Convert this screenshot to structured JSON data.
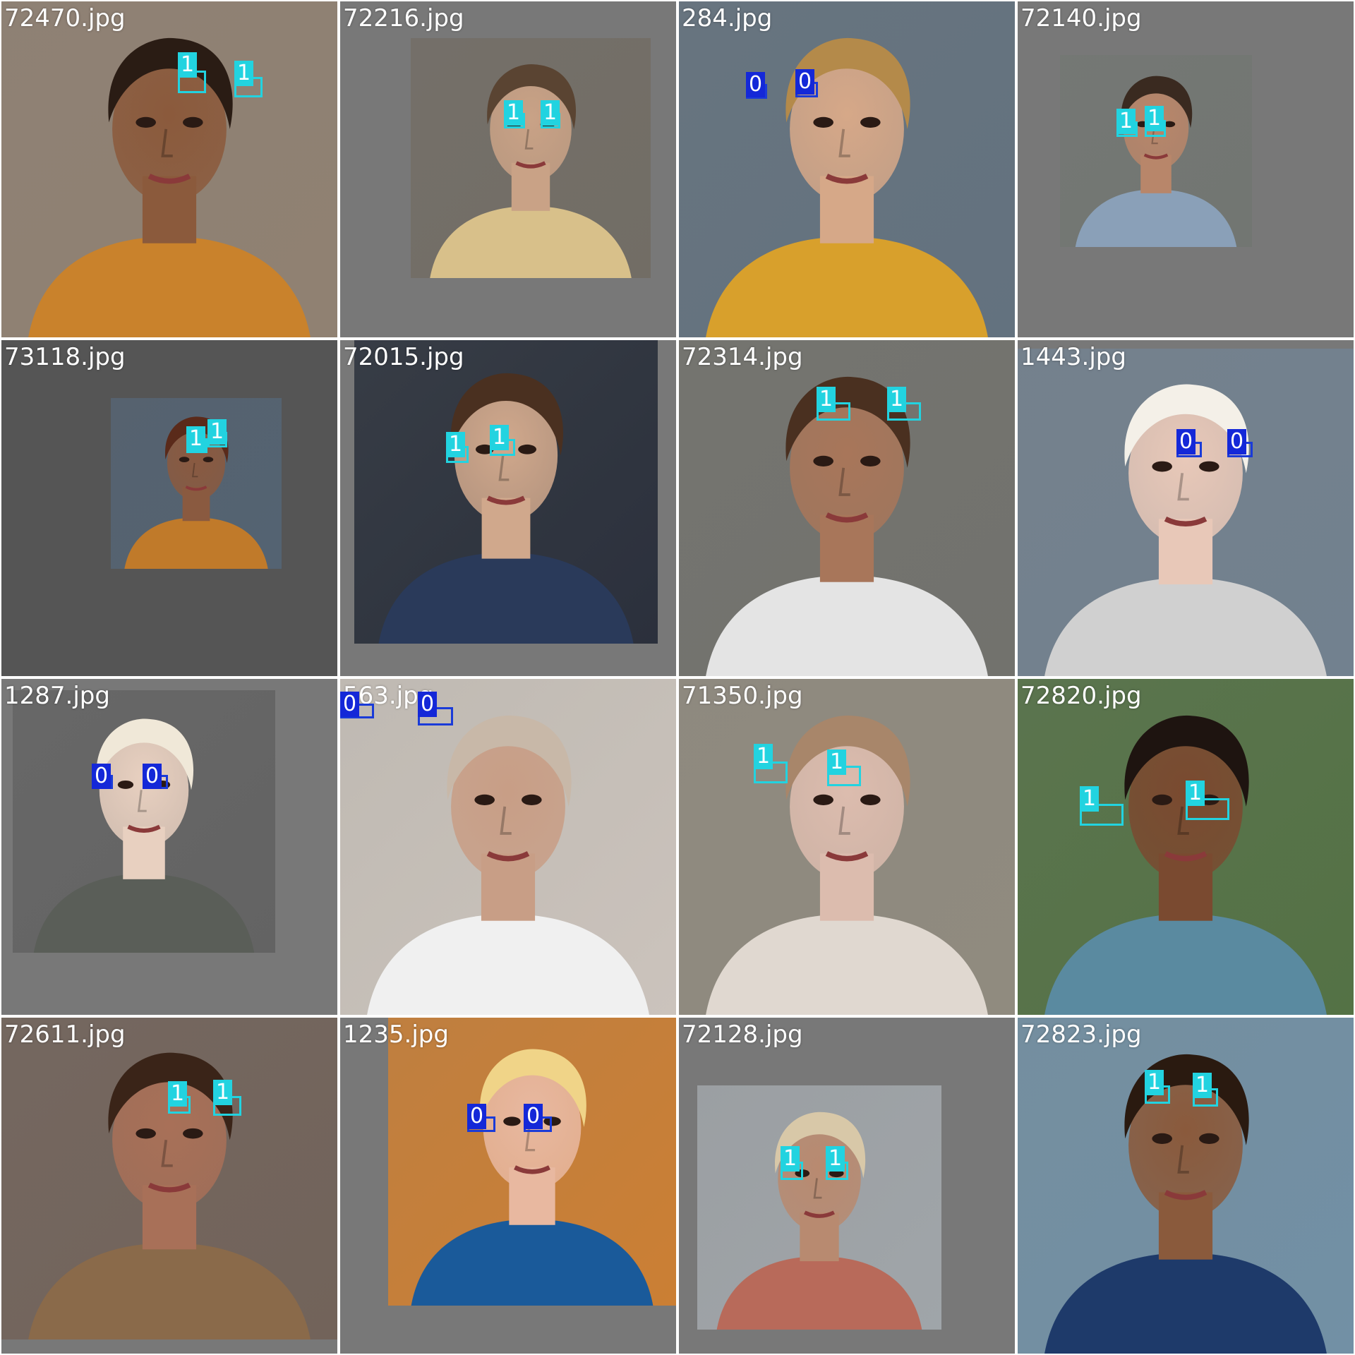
{
  "tiles": [
    {
      "filename": "72470.jpg",
      "detections": [
        {
          "label": "1"
        },
        {
          "label": "1"
        }
      ],
      "colors": {
        "bg": "#8a7a6a",
        "skin": "#8b5a3c",
        "hair": "#2a1c14",
        "cloth": "#c9822c"
      }
    },
    {
      "filename": "72216.jpg",
      "detections": [
        {
          "label": "1"
        },
        {
          "label": "1"
        }
      ],
      "colors": {
        "bg": "#6a645c",
        "skin": "#c9a286",
        "hair": "#5a4432",
        "cloth": "#d8c08a"
      }
    },
    {
      "filename": "284.jpg",
      "detections": [
        {
          "label": "0"
        },
        {
          "label": "0"
        }
      ],
      "colors": {
        "bg": "#5a6a78",
        "skin": "#d6a888",
        "hair": "#b48a4a",
        "cloth": "#d8a02c"
      }
    },
    {
      "filename": "72140.jpg",
      "detections": [
        {
          "label": "1"
        },
        {
          "label": "1"
        }
      ],
      "colors": {
        "bg": "#6a6e6a",
        "skin": "#b8866a",
        "hair": "#3a2a20",
        "cloth": "#8aa0b8"
      }
    },
    {
      "filename": "73118.jpg",
      "detections": [
        {
          "label": "1"
        },
        {
          "label": "1"
        }
      ],
      "colors": {
        "bg": "#4a5a6a",
        "skin": "#8a5a40",
        "hair": "#5a2a1a",
        "cloth": "#c07a2a"
      }
    },
    {
      "filename": "72015.jpg",
      "detections": [
        {
          "label": "1"
        },
        {
          "label": "1"
        }
      ],
      "colors": {
        "bg": "#1e2430",
        "skin": "#d0a88c",
        "hair": "#4a3020",
        "cloth": "#2a3a5a"
      }
    },
    {
      "filename": "72314.jpg",
      "detections": [
        {
          "label": "1"
        },
        {
          "label": "1"
        }
      ],
      "colors": {
        "bg": "#6a6a64",
        "skin": "#a8765a",
        "hair": "#4a3020",
        "cloth": "#e4e4e4"
      }
    },
    {
      "filename": "1443.jpg",
      "detections": [
        {
          "label": "0"
        },
        {
          "label": "0"
        }
      ],
      "colors": {
        "bg": "#6a7a88",
        "skin": "#e8c8b8",
        "hair": "#f4f0e8",
        "cloth": "#d0d0d0"
      }
    },
    {
      "filename": "1287.jpg",
      "detections": [
        {
          "label": "0"
        },
        {
          "label": "0"
        }
      ],
      "colors": {
        "bg": "#5a5a5a",
        "skin": "#e8d0c0",
        "hair": "#f0e8d8",
        "cloth": "#5a5e58"
      }
    },
    {
      "filename": "563.jpg",
      "detections": [
        {
          "label": "0"
        },
        {
          "label": "0"
        }
      ],
      "colors": {
        "bg": "#c8c0b8",
        "skin": "#c89e86",
        "hair": "#c8b8a8",
        "cloth": "#f0f0f0"
      }
    },
    {
      "filename": "71350.jpg",
      "detections": [
        {
          "label": "1"
        },
        {
          "label": "1"
        }
      ],
      "colors": {
        "bg": "#8a8478",
        "skin": "#dcbcae",
        "hair": "#a8866a",
        "cloth": "#e0d8d0"
      }
    },
    {
      "filename": "72820.jpg",
      "detections": [
        {
          "label": "1"
        },
        {
          "label": "1"
        }
      ],
      "colors": {
        "bg": "#4a6a3a",
        "skin": "#7a4a30",
        "hair": "#1e1410",
        "cloth": "#5a8aa0"
      }
    },
    {
      "filename": "72611.jpg",
      "detections": [
        {
          "label": "1"
        },
        {
          "label": "1"
        }
      ],
      "colors": {
        "bg": "#6a5a50",
        "skin": "#a87058",
        "hair": "#3a2418",
        "cloth": "#8a6a4a"
      }
    },
    {
      "filename": "1235.jpg",
      "detections": [
        {
          "label": "0"
        },
        {
          "label": "0"
        }
      ],
      "colors": {
        "bg": "#c87828",
        "skin": "#e8b8a0",
        "hair": "#f0d488",
        "cloth": "#1a5a9a"
      }
    },
    {
      "filename": "72128.jpg",
      "detections": [
        {
          "label": "1"
        },
        {
          "label": "1"
        }
      ],
      "colors": {
        "bg": "#9aa0a4",
        "skin": "#b88a70",
        "hair": "#d8c8a8",
        "cloth": "#b86a5a"
      }
    },
    {
      "filename": "72823.jpg",
      "detections": [
        {
          "label": "1"
        },
        {
          "label": "1"
        }
      ],
      "colors": {
        "bg": "#6a8aa0",
        "skin": "#8a5a3c",
        "hair": "#2a1a10",
        "cloth": "#1e3a6a"
      }
    }
  ]
}
